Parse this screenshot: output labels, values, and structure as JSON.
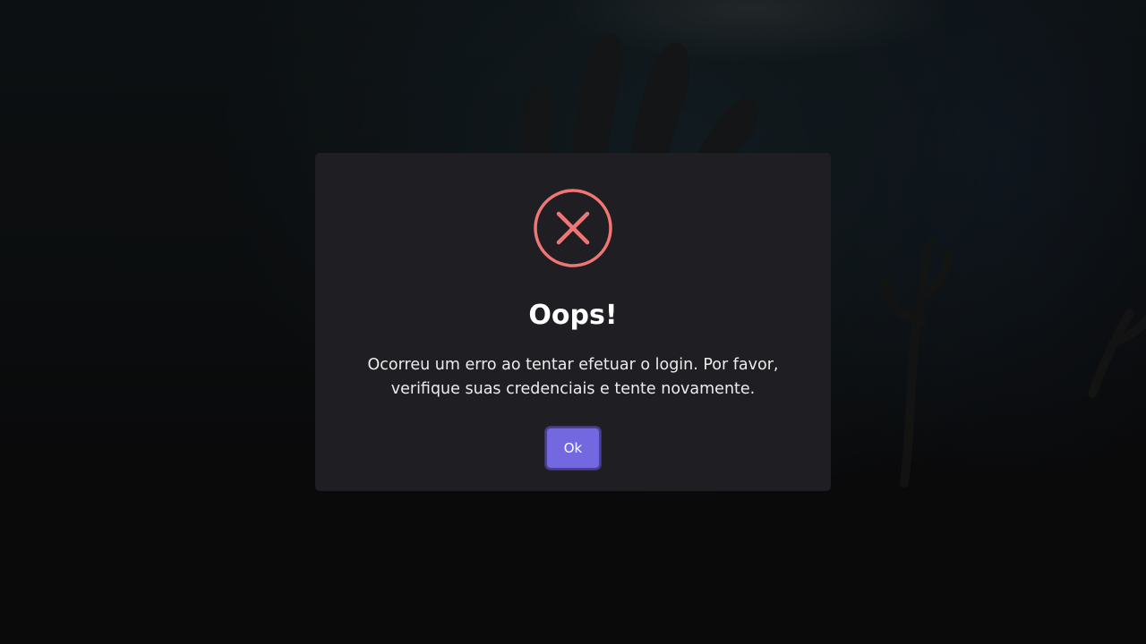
{
  "dialog": {
    "icon": "error-circle-x-icon",
    "title": "Oops!",
    "message": "Ocorreu um erro ao tentar efetuar o login. Por favor, verifique suas credenciais e tente novamente.",
    "ok_label": "Ok"
  },
  "colors": {
    "modal_bg": "#1f1e23",
    "error_accent": "#ee7674",
    "button_bg": "#7468e0",
    "button_border": "#4a3f99",
    "page_bg": "#0b0b0c"
  }
}
